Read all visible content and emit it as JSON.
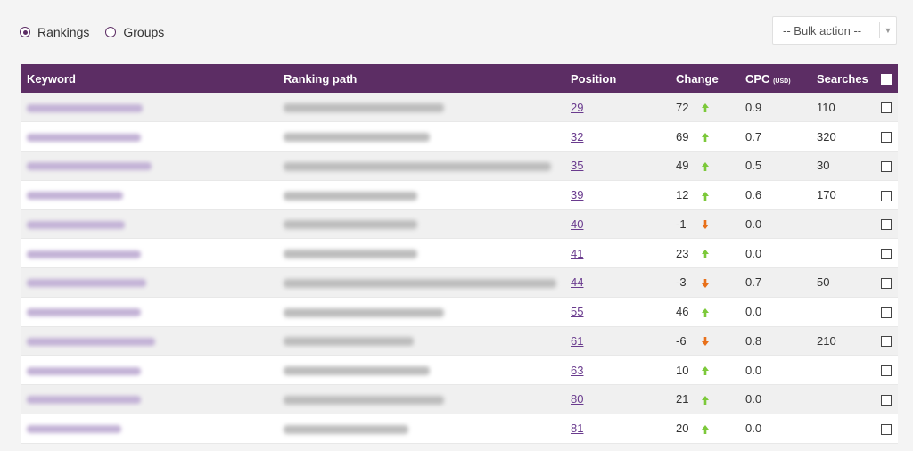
{
  "view_toggle": {
    "options": [
      {
        "label": "Rankings",
        "selected": true
      },
      {
        "label": "Groups",
        "selected": false
      }
    ]
  },
  "bulk_action": {
    "label": "-- Bulk action --"
  },
  "table": {
    "headers": {
      "keyword": "Keyword",
      "ranking_path": "Ranking path",
      "position": "Position",
      "change": "Change",
      "cpc": "CPC",
      "cpc_unit": "(USD)",
      "searches": "Searches"
    },
    "rows": [
      {
        "position": "29",
        "change": "72",
        "direction": "up",
        "cpc": "0.9",
        "searches": "110"
      },
      {
        "position": "32",
        "change": "69",
        "direction": "up",
        "cpc": "0.7",
        "searches": "320"
      },
      {
        "position": "35",
        "change": "49",
        "direction": "up",
        "cpc": "0.5",
        "searches": "30"
      },
      {
        "position": "39",
        "change": "12",
        "direction": "up",
        "cpc": "0.6",
        "searches": "170"
      },
      {
        "position": "40",
        "change": "-1",
        "direction": "down",
        "cpc": "0.0",
        "searches": ""
      },
      {
        "position": "41",
        "change": "23",
        "direction": "up",
        "cpc": "0.0",
        "searches": ""
      },
      {
        "position": "44",
        "change": "-3",
        "direction": "down",
        "cpc": "0.7",
        "searches": "50"
      },
      {
        "position": "55",
        "change": "46",
        "direction": "up",
        "cpc": "0.0",
        "searches": ""
      },
      {
        "position": "61",
        "change": "-6",
        "direction": "down",
        "cpc": "0.8",
        "searches": "210"
      },
      {
        "position": "63",
        "change": "10",
        "direction": "up",
        "cpc": "0.0",
        "searches": ""
      },
      {
        "position": "80",
        "change": "21",
        "direction": "up",
        "cpc": "0.0",
        "searches": ""
      },
      {
        "position": "81",
        "change": "20",
        "direction": "up",
        "cpc": "0.0",
        "searches": ""
      }
    ]
  },
  "colors": {
    "header_bg": "#5c2d64",
    "link": "#6a3b8e",
    "arrow_up": "#7cc93a",
    "arrow_down": "#e8701a"
  },
  "icons": {
    "radio_selected": "radio-selected-icon",
    "radio_unselected": "radio-unselected-icon",
    "caret": "caret-down-icon",
    "arrow_up": "arrow-up-icon",
    "arrow_down": "arrow-down-icon",
    "checkbox": "checkbox-icon"
  }
}
